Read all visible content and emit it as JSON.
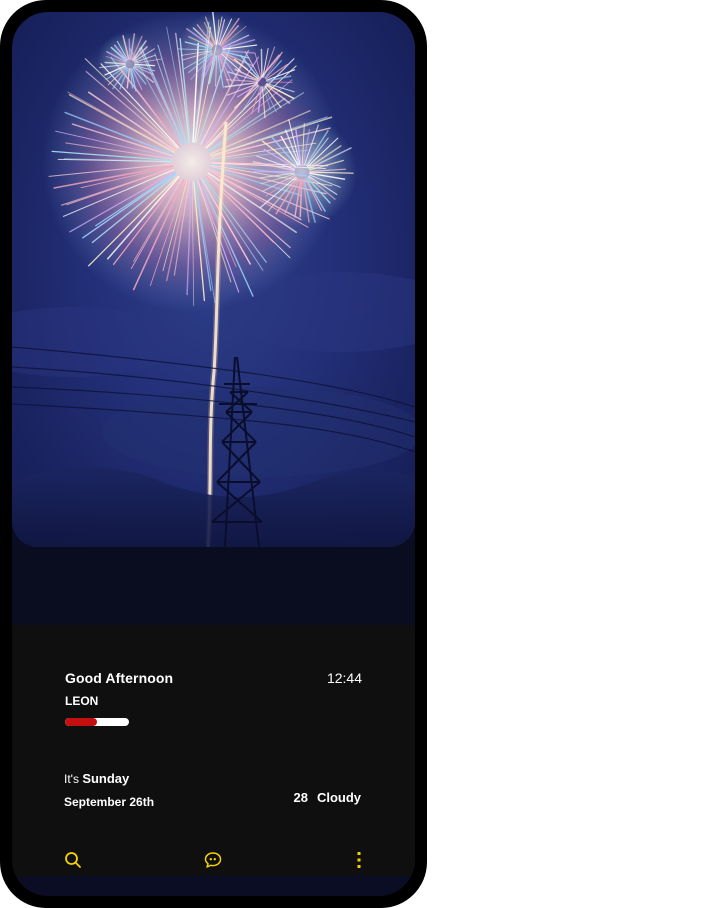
{
  "greeting": "Good Afternoon",
  "time": "12:44",
  "user": "LEON",
  "progress": 0.5,
  "day": {
    "prefix": "It's",
    "name": "Sunday"
  },
  "date": "September 26th",
  "weather": {
    "temperature": "28",
    "condition": "Cloudy"
  },
  "nav": {
    "icons": [
      "search-icon",
      "chat-quote-icon",
      "more-vertical-icon"
    ]
  },
  "colors": {
    "accent": "#f5d300",
    "progress_fill": "#c40f0f",
    "progress_track": "#ffffff",
    "panel": "#0f0f0f",
    "phone_frame": "#000000"
  }
}
